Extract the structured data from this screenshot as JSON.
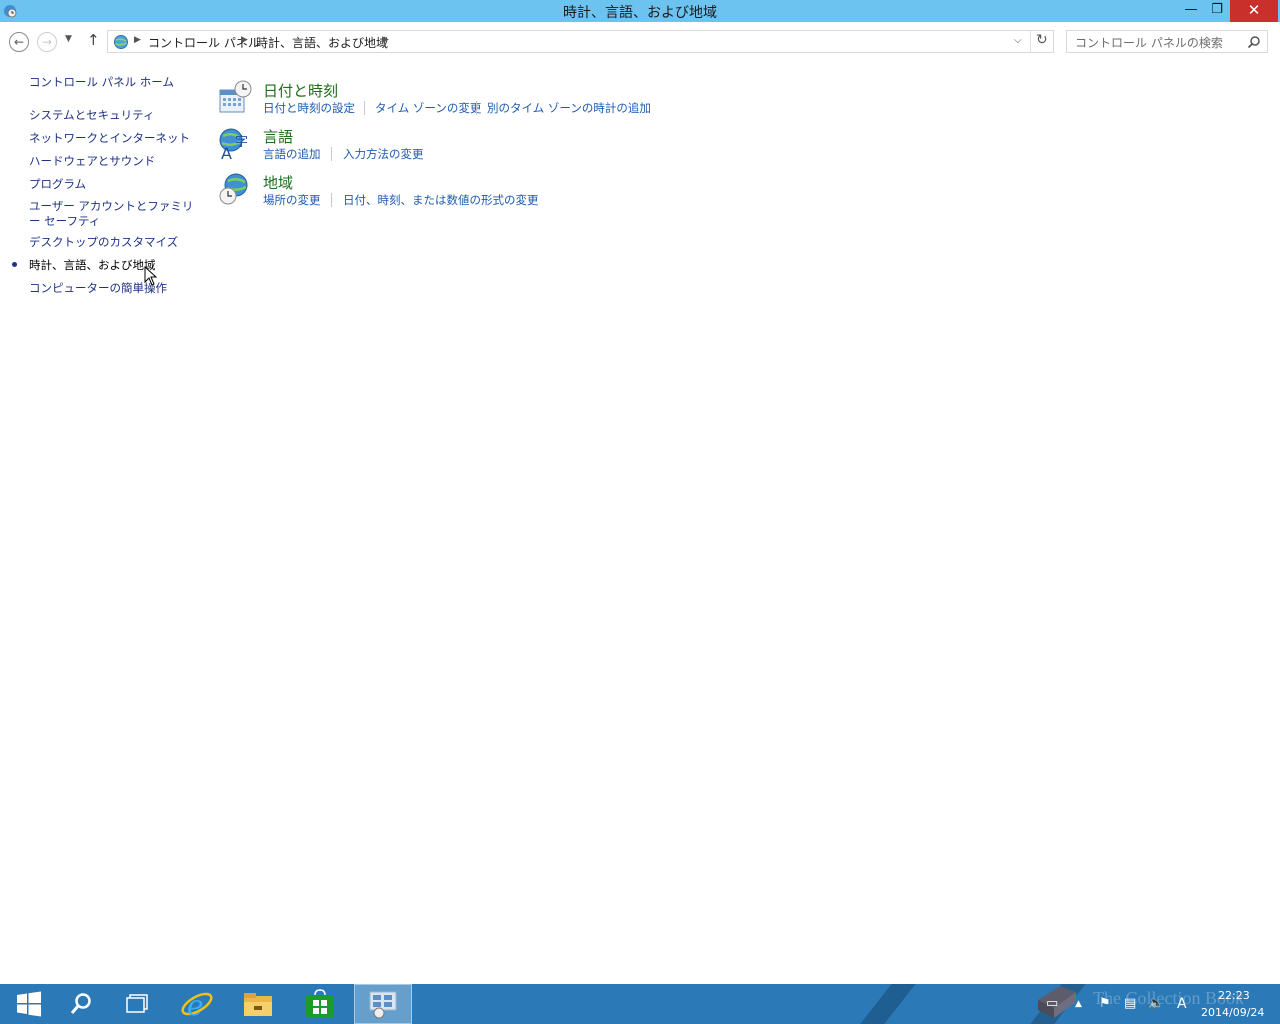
{
  "window": {
    "title": "時計、言語、および地域",
    "min_glyph": "—",
    "max_glyph": "❐",
    "close_glyph": "✕"
  },
  "nav": {
    "back_icon": "back-arrow-icon",
    "forward_icon": "forward-arrow-icon",
    "recent_icon": "chevron-down-icon",
    "up_icon": "up-arrow-icon",
    "breadcrumb": [
      "コントロール パネル",
      "時計、言語、および地域"
    ],
    "search_placeholder": "コントロール パネルの検索"
  },
  "sidebar": {
    "home": "コントロール パネル ホーム",
    "items": [
      {
        "label": "システムとセキュリティ"
      },
      {
        "label": "ネットワークとインターネット"
      },
      {
        "label": "ハードウェアとサウンド"
      },
      {
        "label": "プログラム"
      },
      {
        "label": "ユーザー アカウントとファミリー セーフティ"
      },
      {
        "label": "デスクトップのカスタマイズ"
      },
      {
        "label": "時計、言語、および地域",
        "current": true
      },
      {
        "label": "コンピューターの簡単操作"
      }
    ]
  },
  "categories": [
    {
      "title": "日付と時刻",
      "icon": "calendar-clock-icon",
      "links": [
        "日付と時刻の設定",
        "タイム ゾーンの変更",
        "別のタイム ゾーンの時計の追加"
      ]
    },
    {
      "title": "言語",
      "icon": "language-globe-icon",
      "links": [
        "言語の追加",
        "入力方法の変更"
      ]
    },
    {
      "title": "地域",
      "icon": "region-globe-clock-icon",
      "links": [
        "場所の変更",
        "日付、時刻、または数値の形式の変更"
      ]
    }
  ],
  "taskbar": {
    "items": [
      "start-icon",
      "search-icon",
      "task-view-icon",
      "internet-explorer-icon",
      "file-explorer-icon",
      "store-icon",
      "control-panel-icon"
    ],
    "active_item": "control-panel-icon",
    "tray": {
      "ime": "A",
      "time": "22:23",
      "date": "2014/09/24"
    },
    "watermark": "The Collection Book"
  },
  "colors": {
    "titlebar": "#6cc3f0",
    "taskbar": "#2b7ab7",
    "link": "#1e5bb0",
    "category_title": "#1e6e1e",
    "sidebar_link": "#1e3287"
  }
}
